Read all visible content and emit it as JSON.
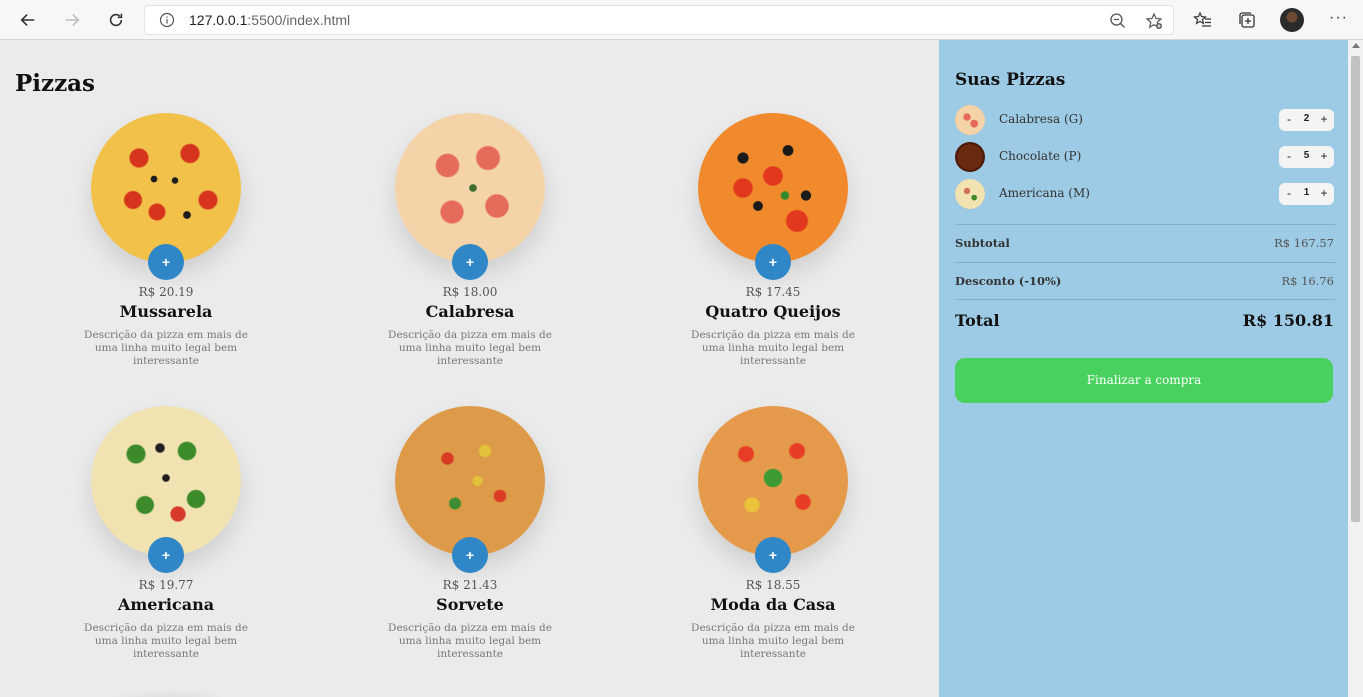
{
  "browser": {
    "url_host": "127.0.0.1",
    "url_rest": ":5500/index.html",
    "icons": [
      "back-arrow-icon",
      "forward-arrow-icon",
      "reload-icon",
      "info-icon",
      "zoom-out-icon",
      "add-favorite-icon",
      "favorites-icon",
      "collections-icon",
      "profile-avatar",
      "more-icon"
    ],
    "more_label": "···"
  },
  "main": {
    "title": "Pizzas",
    "add_label": "+",
    "pizzas": [
      {
        "name": "Mussarela",
        "price": "R$ 20.19",
        "description": "Descrição da pizza em mais de uma linha muito legal bem interessante"
      },
      {
        "name": "Calabresa",
        "price": "R$ 18.00",
        "description": "Descrição da pizza em mais de uma linha muito legal bem interessante"
      },
      {
        "name": "Quatro Queijos",
        "price": "R$ 17.45",
        "description": "Descrição da pizza em mais de uma linha muito legal bem interessante"
      },
      {
        "name": "Americana",
        "price": "R$ 19.77",
        "description": "Descrição da pizza em mais de uma linha muito legal bem interessante"
      },
      {
        "name": "Sorvete",
        "price": "R$ 21.43",
        "description": "Descrição da pizza em mais de uma linha muito legal bem interessante"
      },
      {
        "name": "Moda da Casa",
        "price": "R$ 18.55",
        "description": "Descrição da pizza em mais de uma linha muito legal bem interessante"
      }
    ]
  },
  "cart": {
    "title": "Suas Pizzas",
    "minus_label": "-",
    "plus_label": "+",
    "items": [
      {
        "label": "Calabresa (G)",
        "qty": "2"
      },
      {
        "label": "Chocolate (P)",
        "qty": "5"
      },
      {
        "label": "Americana (M)",
        "qty": "1"
      }
    ],
    "subtotal_label": "Subtotal",
    "subtotal_value": "R$ 167.57",
    "discount_label": "Desconto (-10%)",
    "discount_value": "R$ 16.76",
    "total_label": "Total",
    "total_value": "R$ 150.81",
    "checkout_label": "Finalizar a compra"
  },
  "colors": {
    "accent_blue": "#2f87c7",
    "aside_background": "#9dcbe5",
    "checkout_green": "#48d15e",
    "page_background": "#ebebeb"
  }
}
